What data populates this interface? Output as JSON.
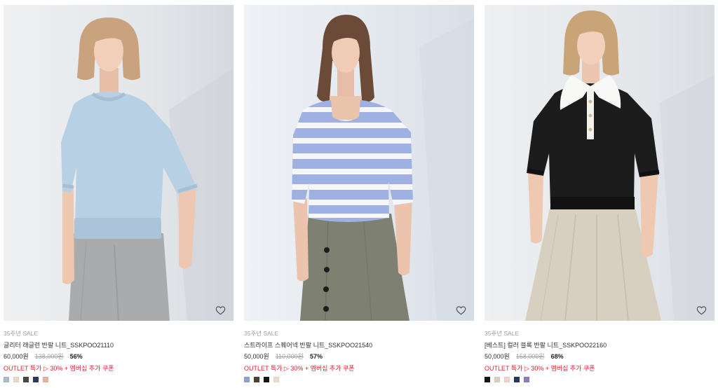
{
  "products": [
    {
      "event_label": "35주년 SALE",
      "name": "글리터 래글런 반팔 니트_SSKPOO21110",
      "sale_price": "60,000원",
      "original_price": "138,000원",
      "discount_rate": "56%",
      "promo": "OUTLET 특가 ▷ 30% + 멤버십 추가 쿠폰",
      "wishlist_icon": "heart-outline-icon",
      "color_swatches": [
        "#a8bbd0",
        "#e9d7c9",
        "#464b42",
        "#2f3a5b",
        "#e3b6a1"
      ]
    },
    {
      "event_label": "35주년 SALE",
      "name": "스트라이프 스퀘어넥 반팔 니트_SSKPOO21540",
      "sale_price": "50,000원",
      "original_price": "110,000원",
      "discount_rate": "57%",
      "promo": "OUTLET 특가 ▷ 30% + 멤버십 추가 쿠폰",
      "wishlist_icon": "heart-outline-icon",
      "color_swatches": [
        "#8fa4d0",
        "#4c4234",
        "#151515",
        "#ecdbce"
      ]
    },
    {
      "event_label": "35주년 SALE",
      "name": "[베스트] 컬러 블록 반팔 니트_SSKPOO22160",
      "sale_price": "50,000원",
      "original_price": "158,000원",
      "discount_rate": "68%",
      "promo": "OUTLET 특가 ▷ 30% + 멤버십 추가 쿠폰",
      "wishlist_icon": "heart-outline-icon",
      "color_swatches": [
        "#141414",
        "#dad0c2",
        "#ebd4cd",
        "#2c3660",
        "#8c7ebd"
      ]
    }
  ],
  "colors": {
    "promo_text": "#e3212d",
    "primary_text": "#333333",
    "muted_text": "#a1a1a1"
  }
}
